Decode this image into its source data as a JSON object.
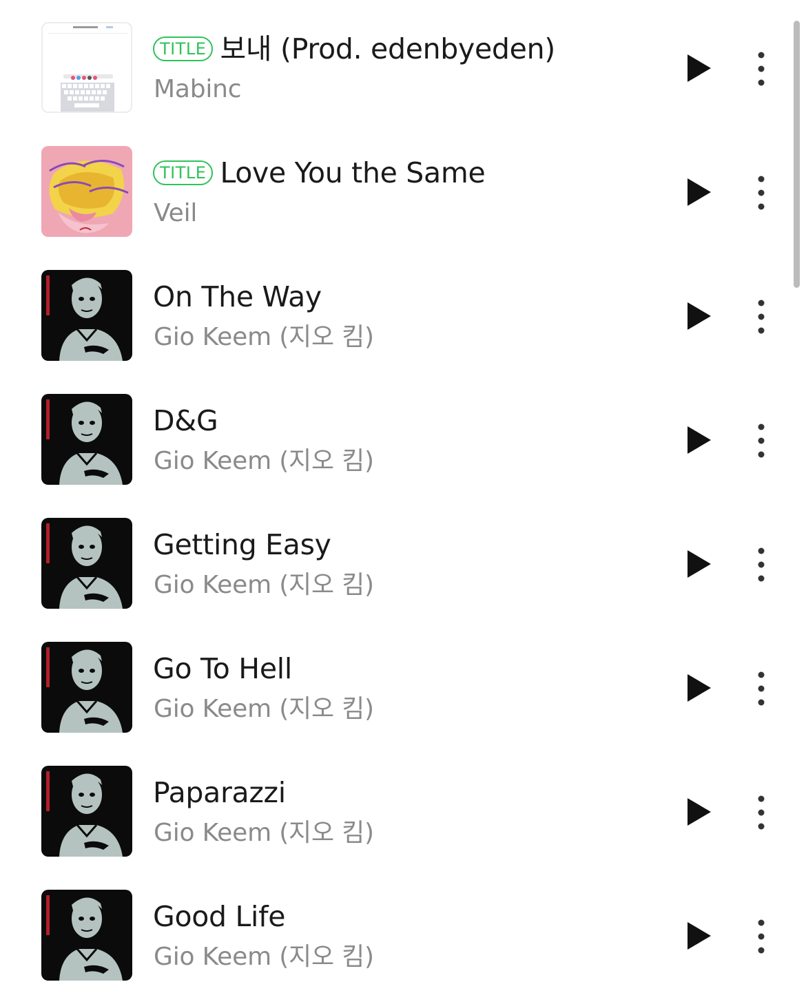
{
  "badge_label": "TITLE",
  "tracks": [
    {
      "title": "보내 (Prod. edenbyeden)",
      "artist": "Mabinc",
      "has_title_badge": true,
      "cover": "keyboard-screenshot-cover"
    },
    {
      "title": "Love You the Same",
      "artist": "Veil",
      "has_title_badge": true,
      "cover": "peach-art-cover"
    },
    {
      "title": "On The Way",
      "artist": "Gio Keem (지오 킴)",
      "has_title_badge": false,
      "cover": "portrait-cover"
    },
    {
      "title": "D&G",
      "artist": "Gio Keem (지오 킴)",
      "has_title_badge": false,
      "cover": "portrait-cover"
    },
    {
      "title": "Getting Easy",
      "artist": "Gio Keem (지오 킴)",
      "has_title_badge": false,
      "cover": "portrait-cover"
    },
    {
      "title": "Go To Hell",
      "artist": "Gio Keem (지오 킴)",
      "has_title_badge": false,
      "cover": "portrait-cover"
    },
    {
      "title": "Paparazzi",
      "artist": "Gio Keem (지오 킴)",
      "has_title_badge": false,
      "cover": "portrait-cover"
    },
    {
      "title": "Good Life",
      "artist": "Gio Keem (지오 킴)",
      "has_title_badge": false,
      "cover": "portrait-cover"
    }
  ],
  "icons": {
    "play": "play-icon",
    "more": "more-vertical-icon"
  },
  "colors": {
    "badge_green": "#2ec25a",
    "title_text": "#1a1a1a",
    "artist_text": "#8a8a8a",
    "icon": "#111111"
  }
}
